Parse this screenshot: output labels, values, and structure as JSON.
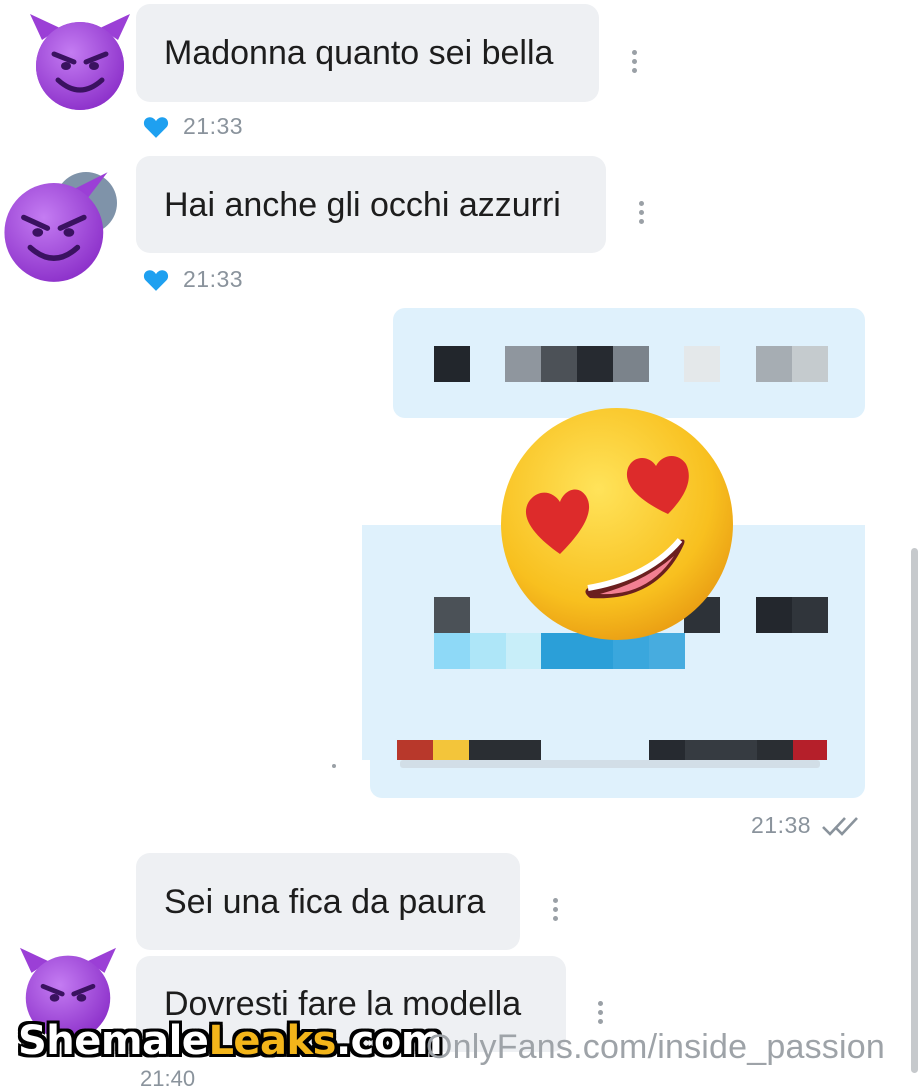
{
  "messages": [
    {
      "text": "Madonna quanto sei bella",
      "time": "21:33",
      "liked": true
    },
    {
      "text": "Hai anche gli occhi azzurri",
      "time": "21:33",
      "liked": true
    },
    {
      "text": "Sei una fica da paura"
    },
    {
      "text": "Dovresti fare la modella",
      "time": "21:40"
    }
  ],
  "outgoing": {
    "time": "21:38",
    "censored": true,
    "emoji": "smiling-face-with-heart-eyes"
  },
  "watermark": {
    "brand_part1": "Shemale",
    "brand_part2": "Leaks",
    "brand_part3": ".com",
    "credit": "OnlyFans.com/inside_passion"
  },
  "colors": {
    "incoming_bubble": "#eef0f3",
    "outgoing_bubble": "#dff1fc",
    "heart": "#1ea0f0",
    "meta_text": "#8a939c",
    "watermark_yellow": "#f3b51a"
  },
  "icons": [
    "devil-emoji-avatar",
    "heart-icon",
    "more-options-icon",
    "double-check-icon",
    "heart-eyes-emoji"
  ]
}
